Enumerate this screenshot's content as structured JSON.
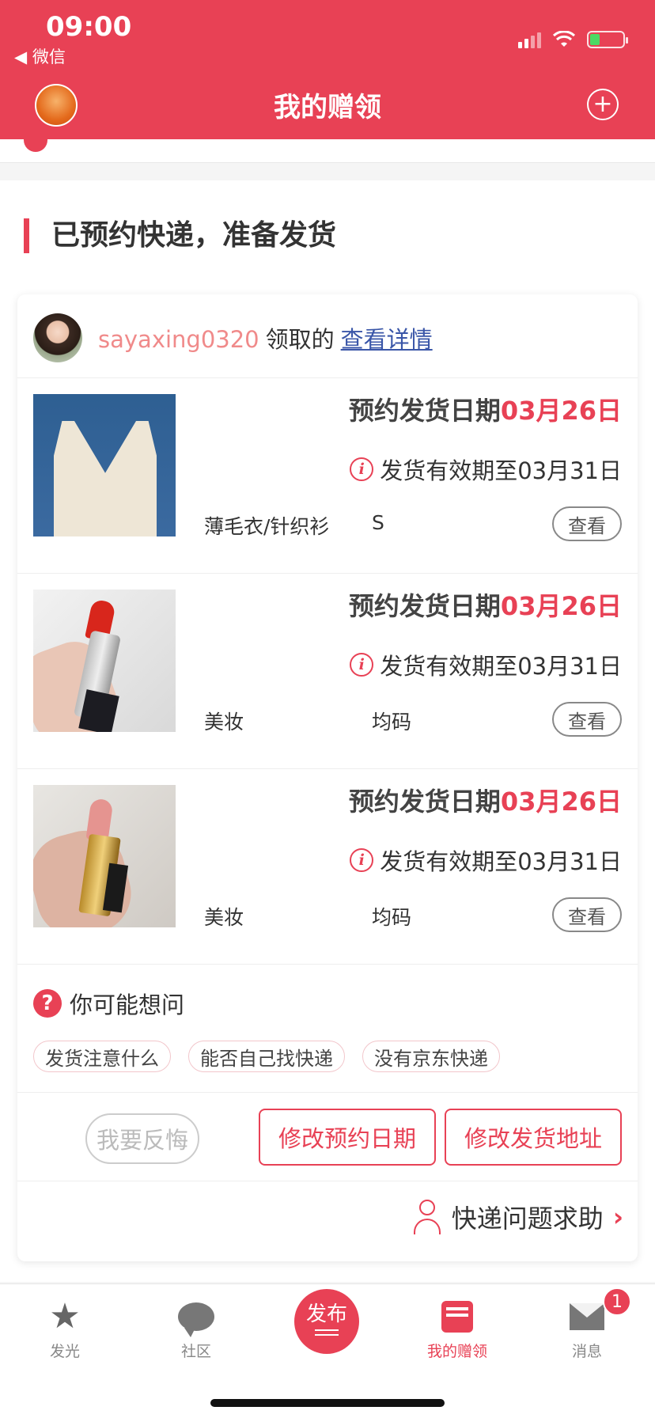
{
  "status_bar": {
    "time": "09:00",
    "back_app": "◀ 微信"
  },
  "header": {
    "title": "我的赠领",
    "plus_symbol": "+"
  },
  "section": {
    "title": "已预约快递，准备发货"
  },
  "claimer": {
    "name": "sayaxing0320",
    "verb": "领取的",
    "detail_link": "查看详情"
  },
  "items": [
    {
      "date_label": "预约发货日期",
      "date_value": "03月26日",
      "valid_text": "发货有效期至03月31日",
      "category": "薄毛衣/针织衫",
      "size": "S",
      "view_label": "查看"
    },
    {
      "date_label": "预约发货日期",
      "date_value": "03月26日",
      "valid_text": "发货有效期至03月31日",
      "category": "美妆",
      "size": "均码",
      "view_label": "查看"
    },
    {
      "date_label": "预约发货日期",
      "date_value": "03月26日",
      "valid_text": "发货有效期至03月31日",
      "category": "美妆",
      "size": "均码",
      "view_label": "查看"
    }
  ],
  "info_symbol": "i",
  "faq": {
    "title": "你可能想问",
    "q_symbol": "?",
    "tags": [
      "发货注意什么",
      "能否自己找快递",
      "没有京东快递"
    ]
  },
  "actions": {
    "regret": "我要反悔",
    "change_date": "修改预约日期",
    "change_address": "修改发货地址"
  },
  "help": {
    "label": "快递问题求助",
    "chevron": "›"
  },
  "tabbar": {
    "faguang": "发光",
    "shequ": "社区",
    "publish": "发布",
    "mine": "我的赠领",
    "messages": "消息",
    "messages_badge": "1"
  },
  "colors": {
    "accent": "#e84155"
  }
}
